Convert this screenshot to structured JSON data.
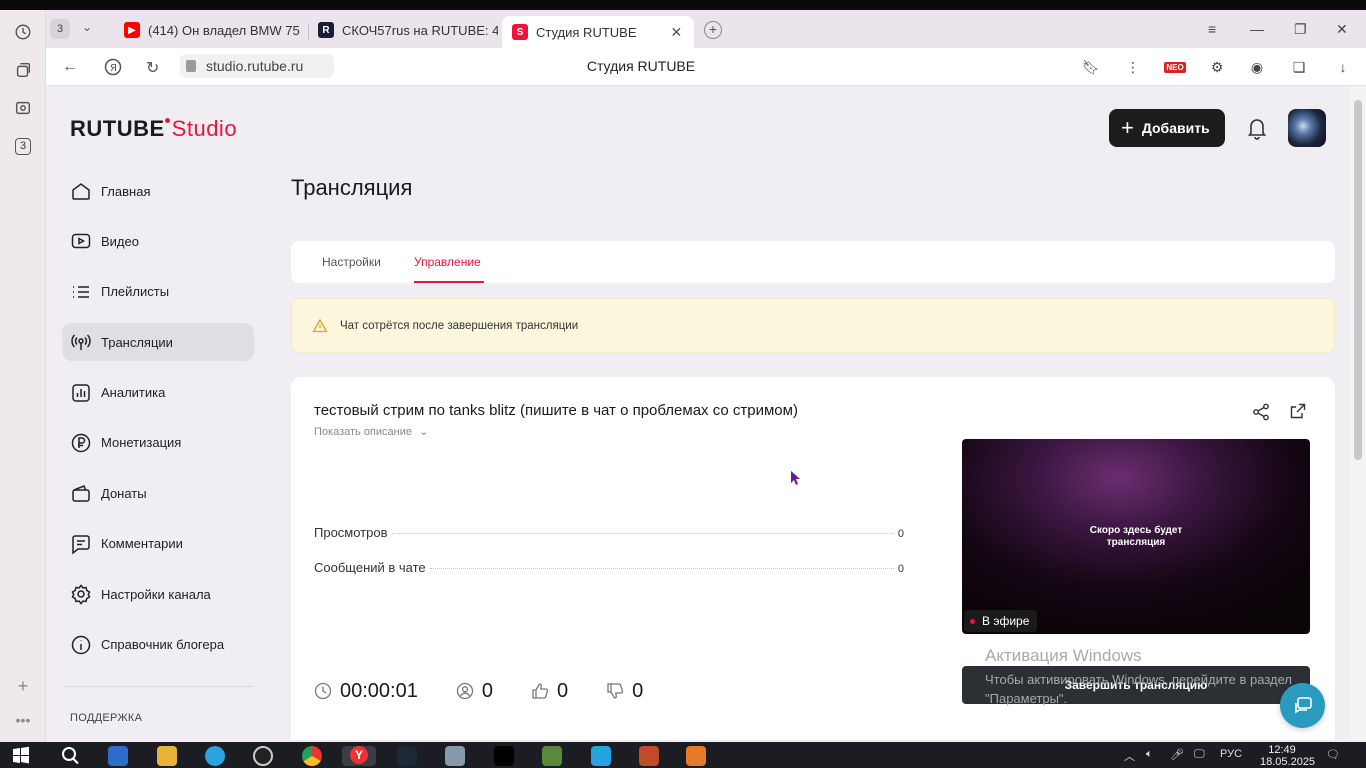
{
  "browser": {
    "tab_count": "3",
    "tabs": [
      {
        "label": "(414) Он владел BMW 75"
      },
      {
        "label": "СКОЧ57rus на RUTUBE: 4"
      },
      {
        "label": "Студия RUTUBE"
      }
    ],
    "url": "studio.rutube.ru",
    "page_title": "Студия RUTUBE",
    "rail_badge": "3"
  },
  "header": {
    "logo_main": "RUTUBE",
    "logo_studio": "Studio",
    "add_button": "Добавить"
  },
  "sidebar": {
    "items": [
      {
        "label": "Главная"
      },
      {
        "label": "Видео"
      },
      {
        "label": "Плейлисты"
      },
      {
        "label": "Трансляции"
      },
      {
        "label": "Аналитика"
      },
      {
        "label": "Монетизация"
      },
      {
        "label": "Донаты"
      },
      {
        "label": "Комментарии"
      },
      {
        "label": "Настройки канала"
      },
      {
        "label": "Справочник блогера"
      }
    ],
    "support": "ПОДДЕРЖКА"
  },
  "main": {
    "title": "Трансляция",
    "tabs": [
      {
        "label": "Настройки"
      },
      {
        "label": "Управление"
      }
    ],
    "notice": "Чат сотрётся после завершения трансляции",
    "stream": {
      "title": "тестовый стрим по tanks blitz (пишите в чат о проблемах со стримом)",
      "show_description": "Показать описание",
      "stats": [
        {
          "label": "Просмотров",
          "value": "0"
        },
        {
          "label": "Сообщений в чате",
          "value": "0"
        }
      ],
      "duration": "00:00:01",
      "viewers": "0",
      "likes": "0",
      "dislikes": "0",
      "preview_message_line1": "Скоро здесь будет",
      "preview_message_line2": "трансляция",
      "live_badge": "В эфире",
      "end_button": "Завершить трансляцию"
    }
  },
  "windows_overlay": {
    "title": "Активация Windows",
    "line1": "Чтобы активировать Windows, перейдите в раздел",
    "line2": "\"Параметры\"."
  },
  "taskbar": {
    "lang": "РУС",
    "time": "12:49",
    "date": "18.05.2025"
  },
  "colors": {
    "accent": "#ed143b",
    "dark_button": "#1c1c1c",
    "notice_bg": "#fcf7dc",
    "chat_fab": "#2a9bbf"
  }
}
